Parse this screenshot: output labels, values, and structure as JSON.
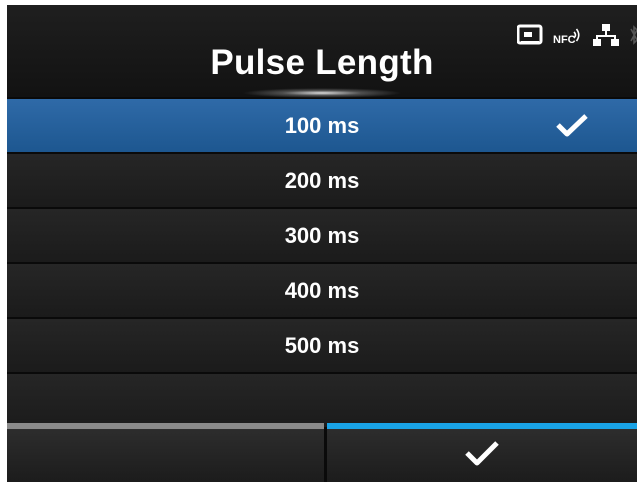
{
  "header": {
    "title": "Pulse Length",
    "status_icons": [
      "card-icon",
      "nfc-icon",
      "network-icon",
      "bluetooth-icon"
    ],
    "nfc_label": "NFC"
  },
  "options": [
    {
      "label": "100 ms",
      "selected": true
    },
    {
      "label": "200 ms",
      "selected": false
    },
    {
      "label": "300 ms",
      "selected": false
    },
    {
      "label": "400 ms",
      "selected": false
    },
    {
      "label": "500 ms",
      "selected": false
    }
  ],
  "footer": {
    "left_button": "back",
    "right_button_icon": "checkmark-icon"
  },
  "colors": {
    "selected_row": "#2262a0",
    "accent_blue": "#19a3e6",
    "background": "#0a0a0a"
  }
}
